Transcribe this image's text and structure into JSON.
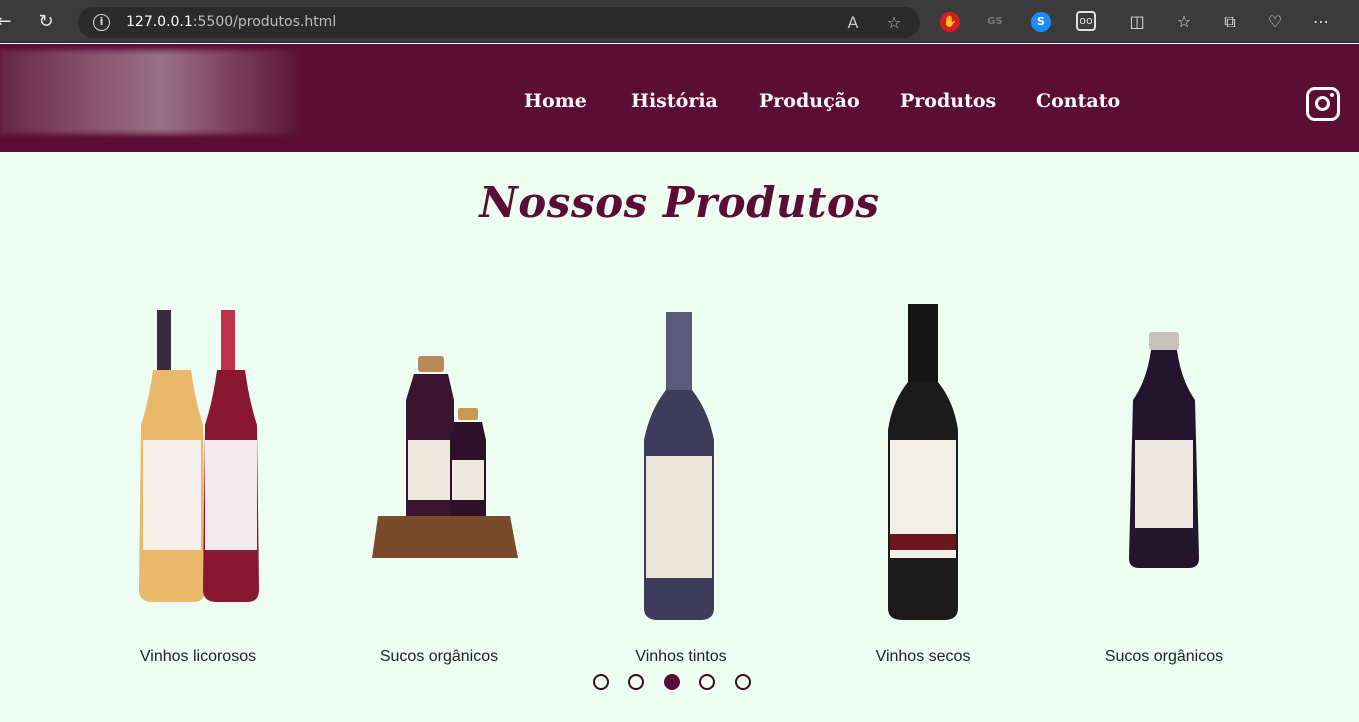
{
  "browser": {
    "url_host": "127.0.0.1",
    "url_path": ":5500/produtos.html",
    "ext_badge": "GS"
  },
  "nav": {
    "items": [
      {
        "label": "Home"
      },
      {
        "label": "História"
      },
      {
        "label": "Produção"
      },
      {
        "label": "Produtos"
      },
      {
        "label": "Contato"
      }
    ]
  },
  "main": {
    "title": "Nossos Produtos",
    "products": [
      {
        "name": "Vinhos licorosos"
      },
      {
        "name": "Sucos orgânicos"
      },
      {
        "name": "Vinhos tintos"
      },
      {
        "name": "Vinhos secos"
      },
      {
        "name": "Sucos orgânicos"
      }
    ],
    "carousel_active_index": 3,
    "carousel_dot_count": 5
  },
  "colors": {
    "brand": "#5c0d34",
    "background": "#eefdf1"
  }
}
